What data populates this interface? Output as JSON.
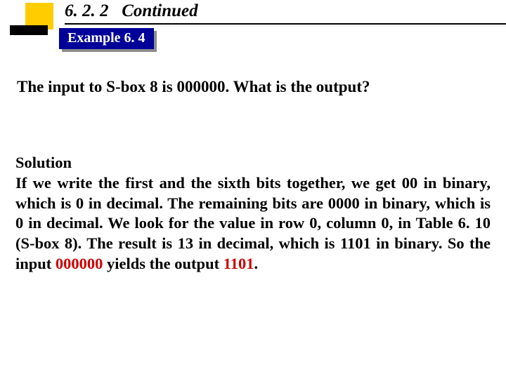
{
  "header": {
    "section_number": "6. 2. 2",
    "section_title": "Continued",
    "example_label": "Example 6. 4"
  },
  "question_text": "The input to S-box 8 is 000000. What is the output?",
  "solution": {
    "label": "Solution",
    "body_before_hl1": "If we write the first and the sixth bits together, we get 00 in binary, which is 0 in decimal. The remaining bits are 0000 in binary, which is 0 in decimal. We look for the value in row 0, column 0, in Table 6. 10 (S-box 8). The result is 13 in decimal, which is 1101 in binary. So the input ",
    "hl1": "000000",
    "between": " yields the output ",
    "hl2": "1101",
    "after": "."
  },
  "colors": {
    "accent_yellow": "#ffcc00",
    "badge_bg": "#000099",
    "highlight": "#cc0000"
  }
}
